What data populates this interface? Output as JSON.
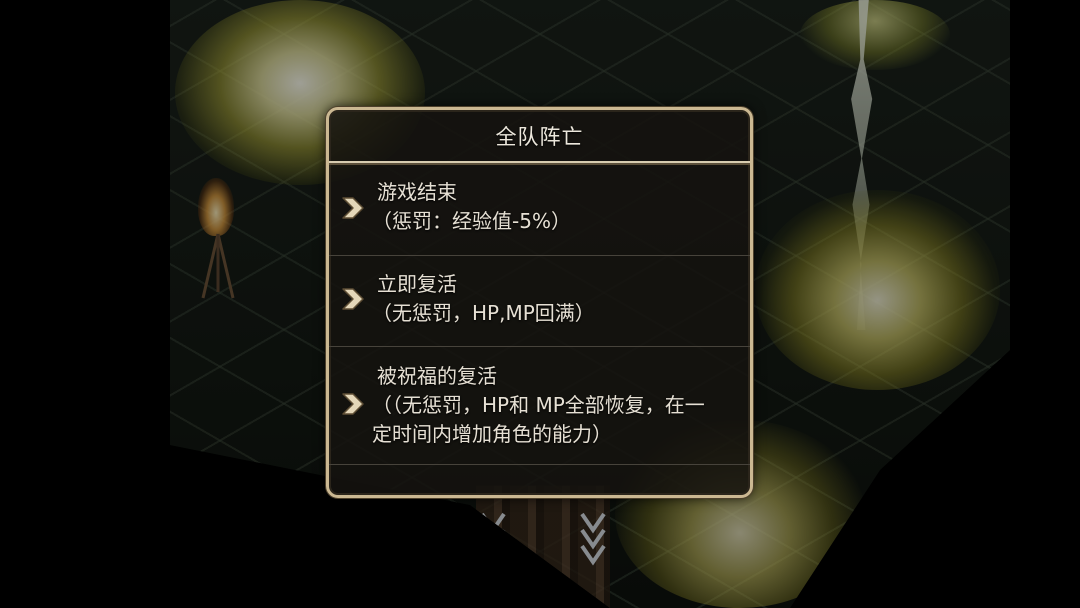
{
  "dialog": {
    "title": "全队阵亡",
    "options": [
      {
        "label": "游戏结束",
        "detail": [
          "（惩罚：经验值-5%）"
        ]
      },
      {
        "label": "立即复活",
        "detail": [
          "（无惩罚，HP,MP回满）"
        ]
      },
      {
        "label": "被祝福的复活",
        "detail": [
          "（（无惩罚，HP和 MP全部恢复，在一",
          "定时间内增加角色的能力）"
        ]
      }
    ]
  },
  "icons": {
    "option_marker": "chevron-right-icon",
    "exit_marker": "down-arrow-icon"
  },
  "theme": {
    "border": "#cbb892",
    "divider": "#d8ccb0",
    "title": "#ece7dc",
    "text": "#e6e0d4",
    "glow": "#e0d86a"
  }
}
